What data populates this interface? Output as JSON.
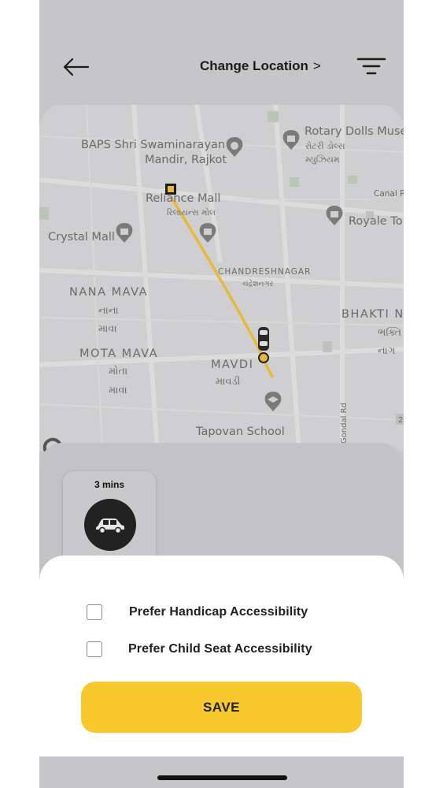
{
  "header": {
    "title": "Change Location",
    "chevron": ">"
  },
  "map": {
    "places": [
      "BAPS Shri Swaminarayan",
      "Mandir, Rajkot",
      "Rotary Dolls Muse",
      "રોટરી ડોલ્સ",
      "મ્યુઝિયમ",
      "Reliance Mall",
      "રિલાયન્સ મોલ",
      "Canal R",
      "Royale To",
      "Crystal Mall",
      "CHANDRESHNAGAR",
      "ચંદ્રેશનગર",
      "NANA MAVA",
      "નાના",
      "માવા",
      "BHAKTI N",
      "ભક્તિ",
      "નાગ",
      "MOTA MAVA",
      "મોતા",
      "માવા",
      "MAVDI",
      "માવડી",
      "Tapovan School",
      "Gondal Rd",
      "2"
    ]
  },
  "eta": {
    "time": "3 mins"
  },
  "options": [
    {
      "label": "Prefer Handicap Accessibility",
      "checked": false
    },
    {
      "label": "Prefer Child Seat Accessibility",
      "checked": false
    }
  ],
  "save_button": {
    "label": "SAVE"
  },
  "colors": {
    "accent": "#f7c92e",
    "route": "#e8b83a",
    "overlay": "#c6c6c8"
  }
}
